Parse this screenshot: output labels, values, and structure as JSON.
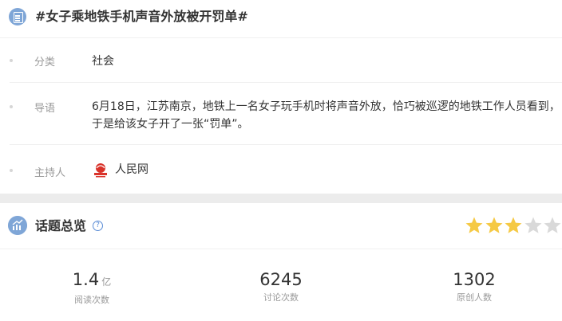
{
  "topic": {
    "title": "#女子乘地铁手机声音外放被开罚单#",
    "icon": "document-icon"
  },
  "info": {
    "category": {
      "label": "分类",
      "value": "社会"
    },
    "lead": {
      "label": "导语",
      "value": "6月18日，江苏南京，地铁上一名女子玩手机时将声音外放，恰巧被巡逻的地铁工作人员看到，于是给该女子开了一张“罚单”。"
    },
    "host": {
      "label": "主持人",
      "name": "人民网",
      "logo": "people-daily-logo"
    }
  },
  "overview": {
    "title": "话题总览",
    "help_icon": "question-circle-icon",
    "help_glyph": "?",
    "rating": {
      "value": 3,
      "max": 5,
      "filled_color": "#f5c944",
      "empty_color": "#d9d9d9"
    }
  },
  "stats": [
    {
      "value": "1.4",
      "unit": "亿",
      "label": "阅读次数"
    },
    {
      "value": "6245",
      "unit": "",
      "label": "讨论次数"
    },
    {
      "value": "1302",
      "unit": "",
      "label": "原创人数"
    }
  ],
  "colors": {
    "accent_icon_bg": "#7fa6d7",
    "help_blue": "#5b8dd6",
    "divider": "#f0f0f0",
    "section_gap": "#ececec"
  }
}
